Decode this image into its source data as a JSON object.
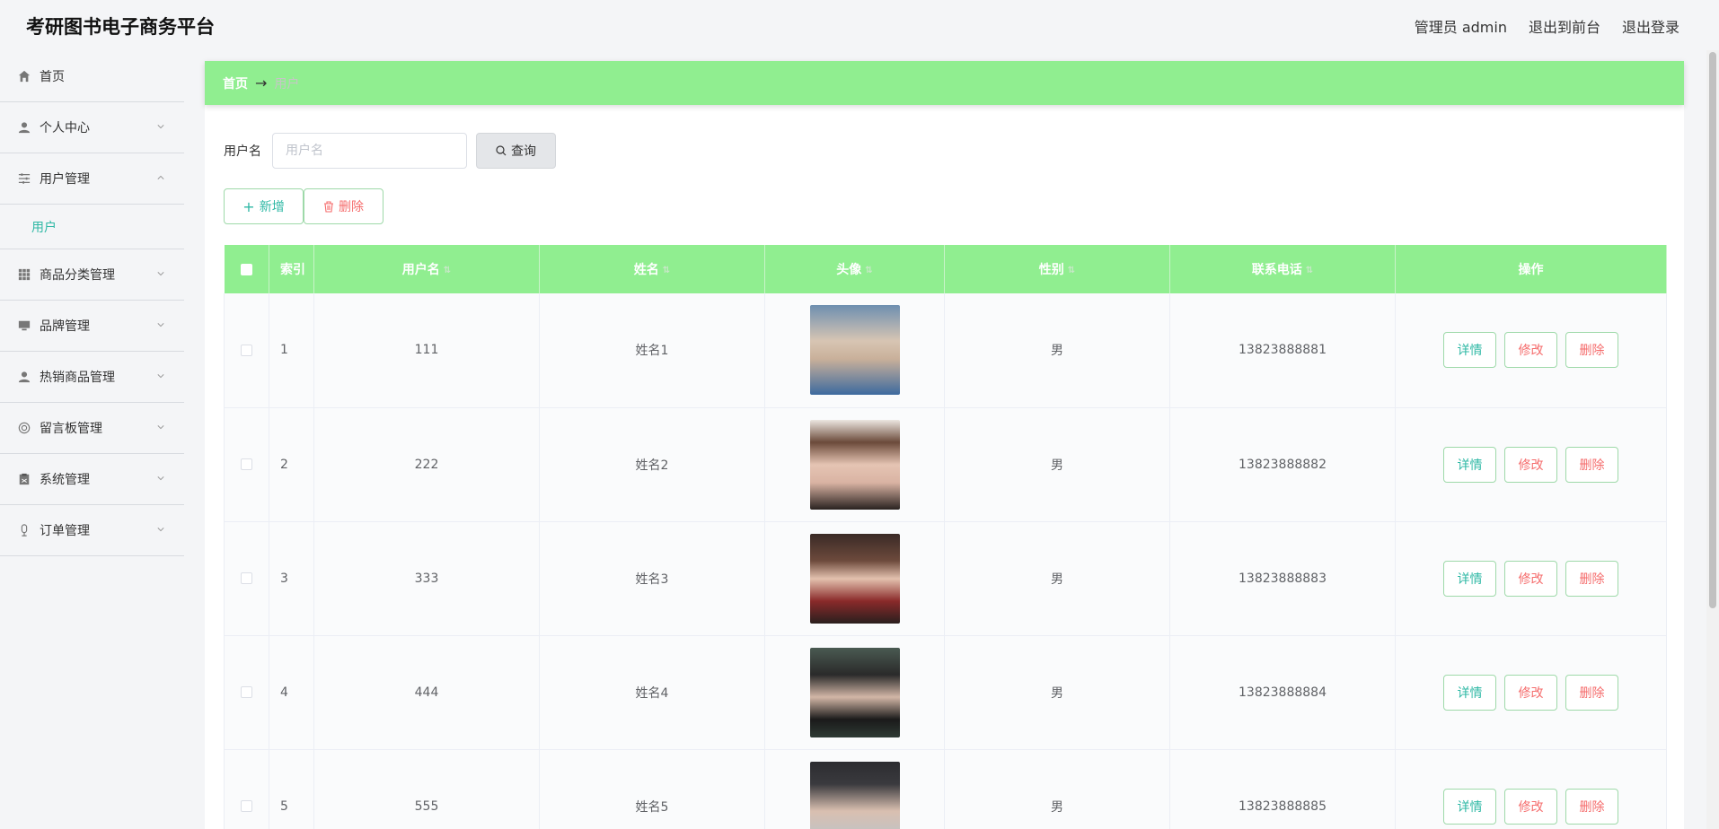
{
  "header": {
    "title": "考研图书电子商务平台",
    "user_label": "管理员 admin",
    "to_front": "退出到前台",
    "logout": "退出登录"
  },
  "sidebar": {
    "items": [
      {
        "label": "首页",
        "icon": "home-icon"
      },
      {
        "label": "个人中心",
        "icon": "user-icon"
      },
      {
        "label": "用户管理",
        "icon": "sliders-icon",
        "expanded": true,
        "children": [
          "用户"
        ]
      },
      {
        "label": "商品分类管理",
        "icon": "grid-icon"
      },
      {
        "label": "品牌管理",
        "icon": "monitor-icon"
      },
      {
        "label": "热销商品管理",
        "icon": "user-icon"
      },
      {
        "label": "留言板管理",
        "icon": "lifebuoy-icon"
      },
      {
        "label": "系统管理",
        "icon": "clipboard-icon"
      },
      {
        "label": "订单管理",
        "icon": "mic-icon"
      }
    ]
  },
  "breadcrumb": {
    "home": "首页",
    "separator": "→",
    "current": "用户"
  },
  "search": {
    "label": "用户名",
    "placeholder": "用户名",
    "value": "",
    "button": "查询"
  },
  "actions": {
    "add": "新增",
    "delete": "删除"
  },
  "table": {
    "columns": [
      "索引",
      "用户名",
      "姓名",
      "头像",
      "性别",
      "联系电话",
      "操作"
    ],
    "rows": [
      {
        "index": "1",
        "username": "111",
        "name": "姓名1",
        "gender": "男",
        "phone": "13823888881"
      },
      {
        "index": "2",
        "username": "222",
        "name": "姓名2",
        "gender": "男",
        "phone": "13823888882"
      },
      {
        "index": "3",
        "username": "333",
        "name": "姓名3",
        "gender": "男",
        "phone": "13823888883"
      },
      {
        "index": "4",
        "username": "444",
        "name": "姓名4",
        "gender": "男",
        "phone": "13823888884"
      },
      {
        "index": "5",
        "username": "555",
        "name": "姓名5",
        "gender": "男",
        "phone": "13823888885"
      }
    ],
    "row_actions": {
      "detail": "详情",
      "edit": "修改",
      "delete": "删除"
    }
  },
  "colors": {
    "accent_green": "#90ee90",
    "teal_text": "#2fb8a5",
    "danger": "#f56c6c"
  }
}
